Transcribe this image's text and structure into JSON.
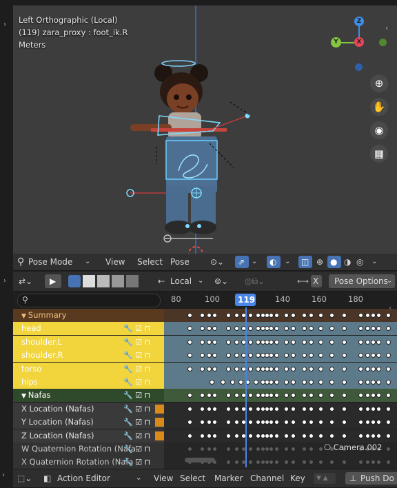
{
  "viewport": {
    "view_name": "Left Orthographic (Local)",
    "frame_object": "(119) zara_proxy : foot_ik.R",
    "units": "Meters",
    "gizmo": {
      "z": "Z",
      "y": "Y",
      "x": "X"
    }
  },
  "viewport_header": {
    "mode": "Pose Mode",
    "menus": [
      "View",
      "Select",
      "Pose"
    ]
  },
  "dopesheet_header": {
    "transform_space": "Local",
    "pose_options": "Pose Options"
  },
  "timeline": {
    "search_placeholder": "",
    "tick_labels": [
      "80",
      "100",
      "119",
      "140",
      "160",
      "180"
    ],
    "current_frame": "119"
  },
  "channels": [
    {
      "label": "Summary",
      "type": "summary"
    },
    {
      "label": "head",
      "type": "group-yellow"
    },
    {
      "label": "shoulder.L",
      "type": "group-yellow"
    },
    {
      "label": "shoulder.R",
      "type": "group-yellow"
    },
    {
      "label": "torso",
      "type": "group-yellow"
    },
    {
      "label": "hips",
      "type": "group-yellow"
    },
    {
      "label": "Nafas",
      "type": "group-green"
    },
    {
      "label": "X Location (Nafas)",
      "type": "fcurve"
    },
    {
      "label": "Y Location (Nafas)",
      "type": "fcurve"
    },
    {
      "label": "Z Location (Nafas)",
      "type": "fcurve"
    },
    {
      "label": "W Quaternion Rotation (Nafa",
      "type": "fcurve-dim"
    },
    {
      "label": "X Quaternion Rotation (Nafa",
      "type": "fcurve-dim"
    }
  ],
  "camera_marker": "Camera.002",
  "bottom_bar": {
    "editor": "Action Editor",
    "menus": [
      "View",
      "Select",
      "Marker",
      "Channel",
      "Key"
    ],
    "push_down": "Push Do"
  },
  "colors": {
    "accent_blue": "#4772b3",
    "group_yellow": "#f2d53c",
    "summary_brown": "#5a3a1e",
    "group_green": "#2f4a2a",
    "playhead": "#4a86e8"
  }
}
